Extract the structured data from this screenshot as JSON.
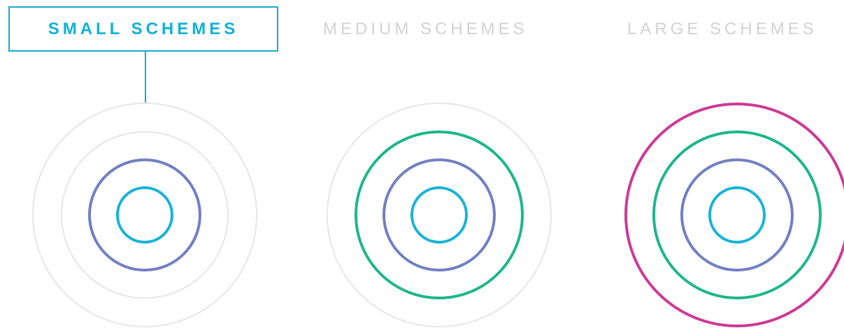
{
  "tabs": [
    {
      "id": "small",
      "label": "SMALL SCHEMES",
      "active": true
    },
    {
      "id": "medium",
      "label": "MEDIUM SCHEMES",
      "active": false
    },
    {
      "id": "large",
      "label": "LARGE SCHEMES",
      "active": false
    }
  ],
  "colors": {
    "accent": "#11b1d6",
    "inactive_text": "#d2d2d6",
    "ring_inactive": "#e6e6e8",
    "ring_level_1": "#19b3d4",
    "ring_level_2": "#727fc2",
    "ring_level_3": "#1db68b",
    "ring_level_4": "#cc3b95"
  },
  "schemes": [
    {
      "name": "small",
      "active_levels": 2,
      "total_levels": 4
    },
    {
      "name": "medium",
      "active_levels": 3,
      "total_levels": 4
    },
    {
      "name": "large",
      "active_levels": 4,
      "total_levels": 4
    }
  ]
}
